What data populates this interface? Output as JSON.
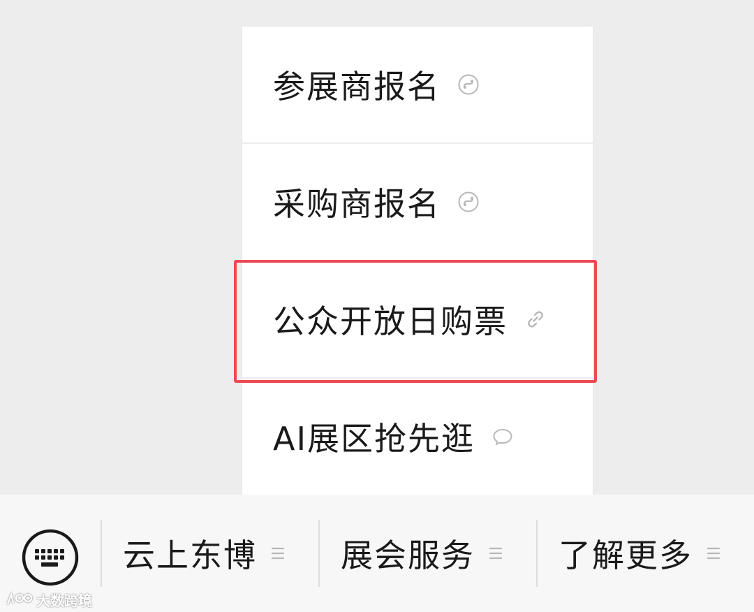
{
  "menu": {
    "items": [
      {
        "label": "参展商报名",
        "icon": "mini-program-icon"
      },
      {
        "label": "采购商报名",
        "icon": "mini-program-icon"
      },
      {
        "label": "公众开放日购票",
        "icon": "link-icon",
        "highlighted": true
      },
      {
        "label": "AI展区抢先逛",
        "icon": "chat-bubble-icon"
      }
    ]
  },
  "bottom_bar": {
    "keyboard_icon": "keyboard-icon",
    "tabs": [
      {
        "label": "云上东博",
        "icon": "menu-lines-icon"
      },
      {
        "label": "展会服务",
        "icon": "menu-lines-icon"
      },
      {
        "label": "了解更多",
        "icon": "menu-lines-icon"
      }
    ]
  },
  "watermark": {
    "text": "大数跨境"
  },
  "colors": {
    "highlight": "#ec4a52",
    "background": "#ededed",
    "bar": "#f7f7f7",
    "text": "#1a1a1a",
    "icon": "#b8b8b8"
  }
}
